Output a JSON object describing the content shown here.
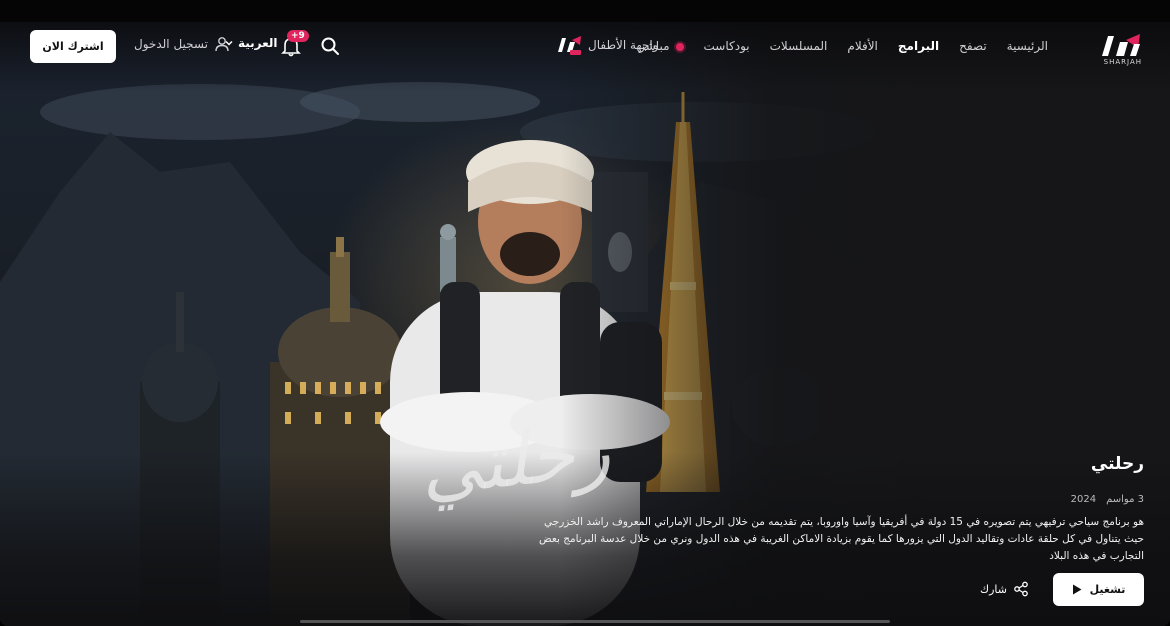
{
  "brand": {
    "logo_sub": "SHARJAH",
    "accent": "#e0245e"
  },
  "nav": {
    "items": [
      {
        "label": "الرئيسية",
        "active": false
      },
      {
        "label": "تصفح",
        "active": false
      },
      {
        "label": "البرامج",
        "active": true
      },
      {
        "label": "الأفلام",
        "active": false
      },
      {
        "label": "المسلسلات",
        "active": false
      },
      {
        "label": "بودكاست",
        "active": false
      },
      {
        "label": "مباشر",
        "active": false,
        "live": true
      }
    ],
    "kids_label": "واجهة الأطفال"
  },
  "header": {
    "notification_count": "9+",
    "language": "العربية",
    "login_label": "تسجيل الدخول",
    "subscribe_label": "اشترك الان"
  },
  "show": {
    "title": "رحلتي",
    "title_art": "رحلتي",
    "seasons": "3 مواسم",
    "year": "2024",
    "description": "هو برنامج سياحي ترفيهي يتم تصويره في 15 دولة في أفريقيا وآسيا واوروبا، يتم تقديمه من خلال الرحال الإماراتي المعروف راشد الخزرجي حيث يتناول في كل حلقة عادات وتقاليد الدول التي يزورها كما يقوم بزيادة الاماكن الغريبة في هذه الدول ونري من خلال عدسة البرنامج بعض التجارب في هذه البلاد",
    "play_label": "تشغيل",
    "share_label": "شارك"
  },
  "icons": {
    "search": "search-icon",
    "bell": "bell-icon",
    "user": "user-icon",
    "chevron": "chevron-down-icon",
    "play": "play-icon",
    "share": "share-icon"
  }
}
